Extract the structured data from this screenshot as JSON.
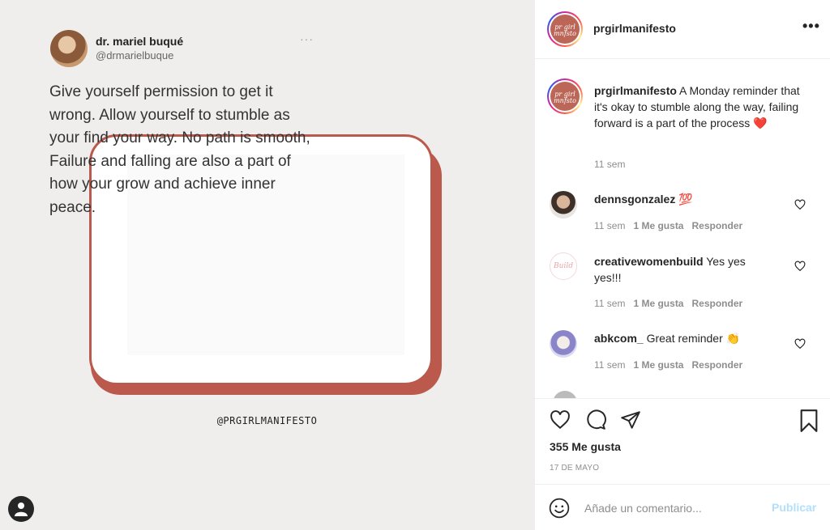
{
  "post_image": {
    "tweet_name": "dr. mariel buqué",
    "tweet_handle": "@drmarielbuque",
    "tweet_more": "···",
    "tweet_text": "Give yourself permission to get it wrong. Allow yourself to stumble as your find your way. No path is smooth, Failure and falling are also a part of how your grow and achieve inner peace.",
    "tag": "@PRGIRLMANIFESTO",
    "brand_color": "#bb5a4c"
  },
  "header": {
    "username": "prgirlmanifesto",
    "more": "•••"
  },
  "caption": {
    "username": "prgirlmanifesto",
    "text": "A Monday reminder that it's okay to stumble along the way, failing forward is a part of the process",
    "emoji": "❤️",
    "time": "11 sem"
  },
  "comments": [
    {
      "username": "dennsgonzalez",
      "text": "",
      "emoji": "💯",
      "time": "11 sem",
      "likes": "1 Me gusta",
      "reply": "Responder"
    },
    {
      "username": "creativewomenbuild",
      "text": "Yes yes yes!!!",
      "emoji": "",
      "time": "11 sem",
      "likes": "1 Me gusta",
      "reply": "Responder"
    },
    {
      "username": "abkcom_",
      "text": "Great reminder",
      "emoji": "👏",
      "time": "11 sem",
      "likes": "1 Me gusta",
      "reply": "Responder"
    }
  ],
  "actions": {
    "likes": "355 Me gusta",
    "date": "17 DE MAYO"
  },
  "add_comment": {
    "placeholder": "Añade un comentario...",
    "publish": "Publicar"
  }
}
